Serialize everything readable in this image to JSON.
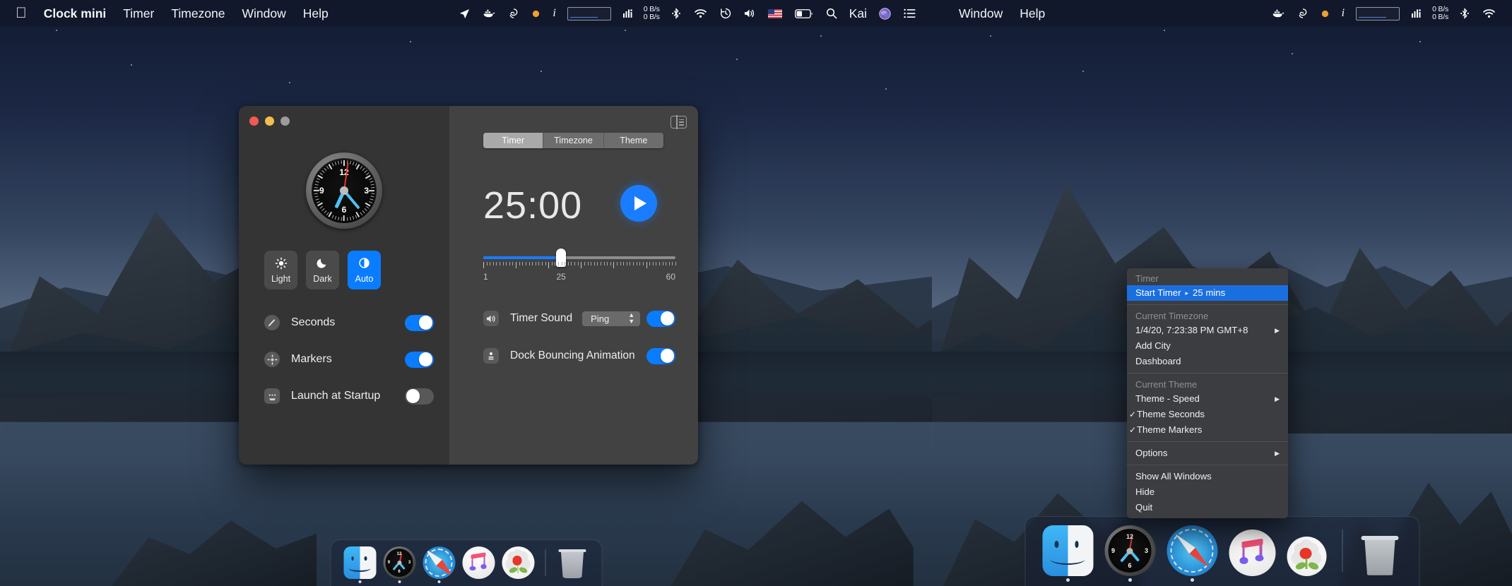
{
  "left_screen": {
    "menubar": {
      "apple_icon": "apple-logo",
      "items": [
        {
          "label": "Clock mini",
          "bold": true
        },
        {
          "label": "Timer",
          "bold": false
        },
        {
          "label": "Timezone",
          "bold": false
        },
        {
          "label": "Window",
          "bold": false
        },
        {
          "label": "Help",
          "bold": false
        }
      ],
      "status_icons": [
        "location-arrow-icon",
        "docker-whale-icon",
        "creative-cloud-icon",
        "orange-dot-icon",
        "info-italic-icon"
      ],
      "search_box_value": "",
      "network_speed_up": "0 B/s",
      "network_speed_down": "0 B/s",
      "right_icons": [
        "equalizer-icon",
        "bluetooth-icon",
        "wifi-icon",
        "time-machine-icon",
        "volume-icon",
        "us-flag-icon",
        "battery-icon",
        "spotlight-search-icon"
      ],
      "user_name": "Kai",
      "siri_icon": "siri-icon",
      "control_center_icon": "control-center-icon"
    },
    "dock": {
      "items": [
        {
          "name": "finder",
          "running": true
        },
        {
          "name": "clock-mini",
          "running": true
        },
        {
          "name": "safari",
          "running": true
        },
        {
          "name": "music",
          "running": false
        },
        {
          "name": "photos",
          "running": false
        }
      ],
      "trash": {
        "name": "trash"
      }
    }
  },
  "window": {
    "traffic_lights": [
      "close-button",
      "minimize-button",
      "zoom-button"
    ],
    "sidebar_toggle_icon": "sidebar-toggle-icon",
    "clock": {
      "numbers": [
        "12",
        "3",
        "6",
        "9"
      ],
      "hour_hand_deg": 205,
      "minute_hand_deg": 140,
      "second_hand_deg": 8
    },
    "theme_buttons": [
      {
        "label": "Light",
        "icon": "sun-icon",
        "active": false
      },
      {
        "label": "Dark",
        "icon": "moon-icon",
        "active": false
      },
      {
        "label": "Auto",
        "icon": "half-circle-icon",
        "active": true
      }
    ],
    "sidebar_rows": [
      {
        "label": "Seconds",
        "icon": "second-hand-icon",
        "on": true
      },
      {
        "label": "Markers",
        "icon": "markers-icon",
        "on": true
      },
      {
        "label": "Launch at Startup",
        "icon": "startup-icon",
        "on": false
      }
    ],
    "tabs": [
      {
        "label": "Timer",
        "active": true
      },
      {
        "label": "Timezone",
        "active": false
      },
      {
        "label": "Theme",
        "active": false
      }
    ],
    "timer_display": "25:00",
    "play_button_icon": "play-icon",
    "slider": {
      "min_label": "1",
      "value_label": "25",
      "max_label": "60",
      "value": 25,
      "min": 1,
      "max": 60
    },
    "main_rows": [
      {
        "label": "Timer Sound",
        "icon": "speaker-icon",
        "select_value": "Ping",
        "on": true
      },
      {
        "label": "Dock Bouncing Animation",
        "icon": "dock-bounce-icon",
        "on": true
      }
    ],
    "accent_color": "#0a7cff"
  },
  "right_screen": {
    "menubar": {
      "items": [
        {
          "label": "Window",
          "bold": false
        },
        {
          "label": "Help",
          "bold": false
        }
      ],
      "status_icons": [
        "docker-whale-icon",
        "creative-cloud-icon",
        "orange-dot-icon",
        "info-italic-icon"
      ],
      "search_box_value": "",
      "network_speed_up": "0 B/s",
      "network_speed_down": "0 B/s",
      "right_icons": [
        "equalizer-icon",
        "bluetooth-icon",
        "wifi-icon"
      ]
    },
    "dropdown_menu": {
      "sections": [
        {
          "header": "Timer",
          "items": [
            {
              "label": "Start Timer",
              "value": "25 mins",
              "highlighted": true,
              "separator_dot": true
            }
          ]
        },
        {
          "header": "Current Timezone",
          "items": [
            {
              "label": "1/4/20, 7:23:38 PM GMT+8",
              "submenu": true
            },
            {
              "label": "Add City"
            },
            {
              "label": "Dashboard"
            }
          ]
        },
        {
          "header": "Current Theme",
          "items": [
            {
              "label": "Theme - Speed",
              "submenu": true
            },
            {
              "label": "Theme Seconds",
              "checked": true
            },
            {
              "label": "Theme Markers",
              "checked": true
            }
          ]
        },
        {
          "header": null,
          "items": [
            {
              "label": "Options",
              "submenu": true
            }
          ]
        },
        {
          "header": null,
          "items": [
            {
              "label": "Show All Windows"
            },
            {
              "label": "Hide"
            },
            {
              "label": "Quit"
            }
          ]
        }
      ],
      "highlight_color": "#1a6fe0"
    },
    "dock": {
      "items": [
        {
          "name": "finder",
          "running": true
        },
        {
          "name": "clock-mini",
          "running": true
        },
        {
          "name": "safari",
          "running": true
        },
        {
          "name": "music",
          "running": false
        },
        {
          "name": "photos",
          "running": false
        }
      ],
      "trash": {
        "name": "trash"
      }
    }
  }
}
